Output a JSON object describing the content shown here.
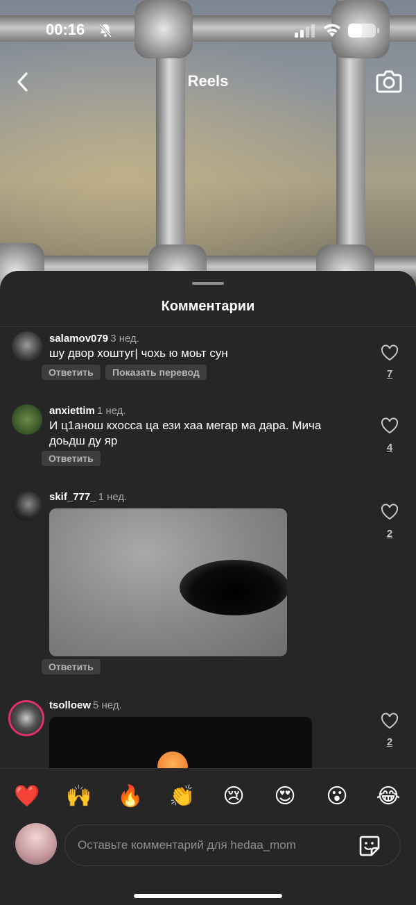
{
  "status": {
    "time": "00:16",
    "battery": "37"
  },
  "header": {
    "title": "Reels"
  },
  "sheet": {
    "title": "Комментарии"
  },
  "comments": [
    {
      "username": "salamov079",
      "ago": "3 нед.",
      "text": "шу двор хоштуг| чохь ю моьт сун",
      "reply_label": "Ответить",
      "translate_label": "Показать перевод",
      "likes": "7"
    },
    {
      "username": "anxiettim",
      "ago": "1 нед.",
      "text": "И ц1анош кхосса ца ези хаа мегар ма дара. Мича доьдш ду яр",
      "reply_label": "Ответить",
      "likes": "4"
    },
    {
      "username": "skif_777_",
      "ago": "1 нед.",
      "reply_label": "Ответить",
      "likes": "2"
    },
    {
      "username": "tsolloew",
      "ago": "5 нед.",
      "likes": "2"
    }
  ],
  "quick_emojis": [
    {
      "name": "red-heart",
      "char": "❤️"
    },
    {
      "name": "raising-hands",
      "char": "🙌"
    },
    {
      "name": "fire",
      "char": "🔥"
    },
    {
      "name": "clapping-hands",
      "char": "👏"
    },
    {
      "name": "crying-face",
      "char": "😢"
    },
    {
      "name": "heart-eyes",
      "char": "😍"
    },
    {
      "name": "astonished-face",
      "char": "😮"
    },
    {
      "name": "tears-of-joy",
      "char": "😂"
    }
  ],
  "composer": {
    "placeholder": "Оставьте комментарий для hedaa_mom"
  },
  "icons": [
    "chevron-left-icon",
    "camera-icon",
    "heart-icon",
    "sticker-icon",
    "silent-bell-icon",
    "signal-icon",
    "wifi-icon",
    "battery-icon"
  ]
}
